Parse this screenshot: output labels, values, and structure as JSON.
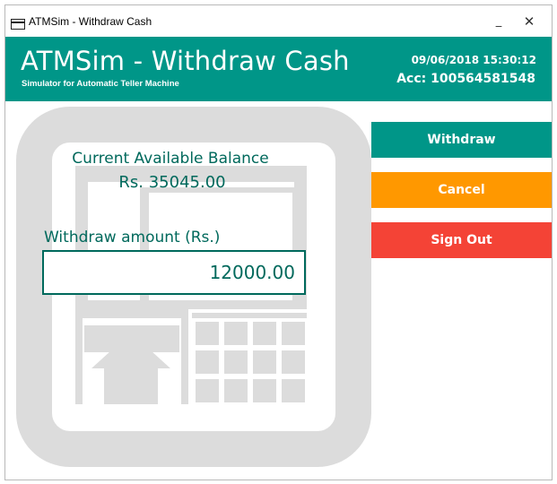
{
  "window": {
    "title": "ATMSim - Withdraw Cash",
    "minimize_glyph": "_",
    "close_glyph": "✕"
  },
  "header": {
    "title": "ATMSim - Withdraw Cash",
    "subtitle": "Simulator for Automatic Teller Machine",
    "datetime": "09/06/2018 15:30:12",
    "account": "Acc: 100564581548"
  },
  "balance": {
    "label": "Current Available Balance",
    "value": "Rs. 35045.00"
  },
  "withdraw": {
    "label": "Withdraw amount (Rs.)",
    "amount": "12000.00"
  },
  "actions": {
    "withdraw": "Withdraw",
    "cancel": "Cancel",
    "sign_out": "Sign Out"
  },
  "colors": {
    "primary": "#009688",
    "primary_dark": "#00695c",
    "warning": "#ff9800",
    "danger": "#f44336",
    "art": "#dcdcdc"
  },
  "icons": {
    "app": "window-card-icon",
    "background": "atm-machine-icon"
  }
}
